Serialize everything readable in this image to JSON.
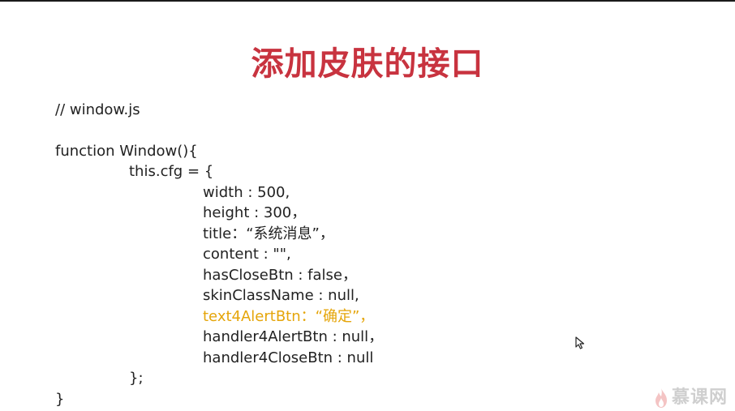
{
  "slide": {
    "title": "添加皮肤的接口",
    "code": [
      "// window.js",
      "function Window(){",
      "this.cfg = {",
      "width : 500,",
      "height : 300，",
      "title：“系统消息”，",
      "content : \"\",",
      "hasCloseBtn : false，",
      "skinClassName : null,",
      "text4AlertBtn：“确定”，",
      "handler4AlertBtn : null，",
      "handler4CloseBtn : null",
      "};",
      "}"
    ]
  },
  "watermark": {
    "logo_text": "慕课网",
    "icon": "flame-icon"
  },
  "colors": {
    "title": "#c8333f",
    "highlight": "#e5a50a",
    "code_text": "#222222",
    "logo": "#cfcfcf"
  },
  "cursor_icon": "mouse-pointer-icon"
}
